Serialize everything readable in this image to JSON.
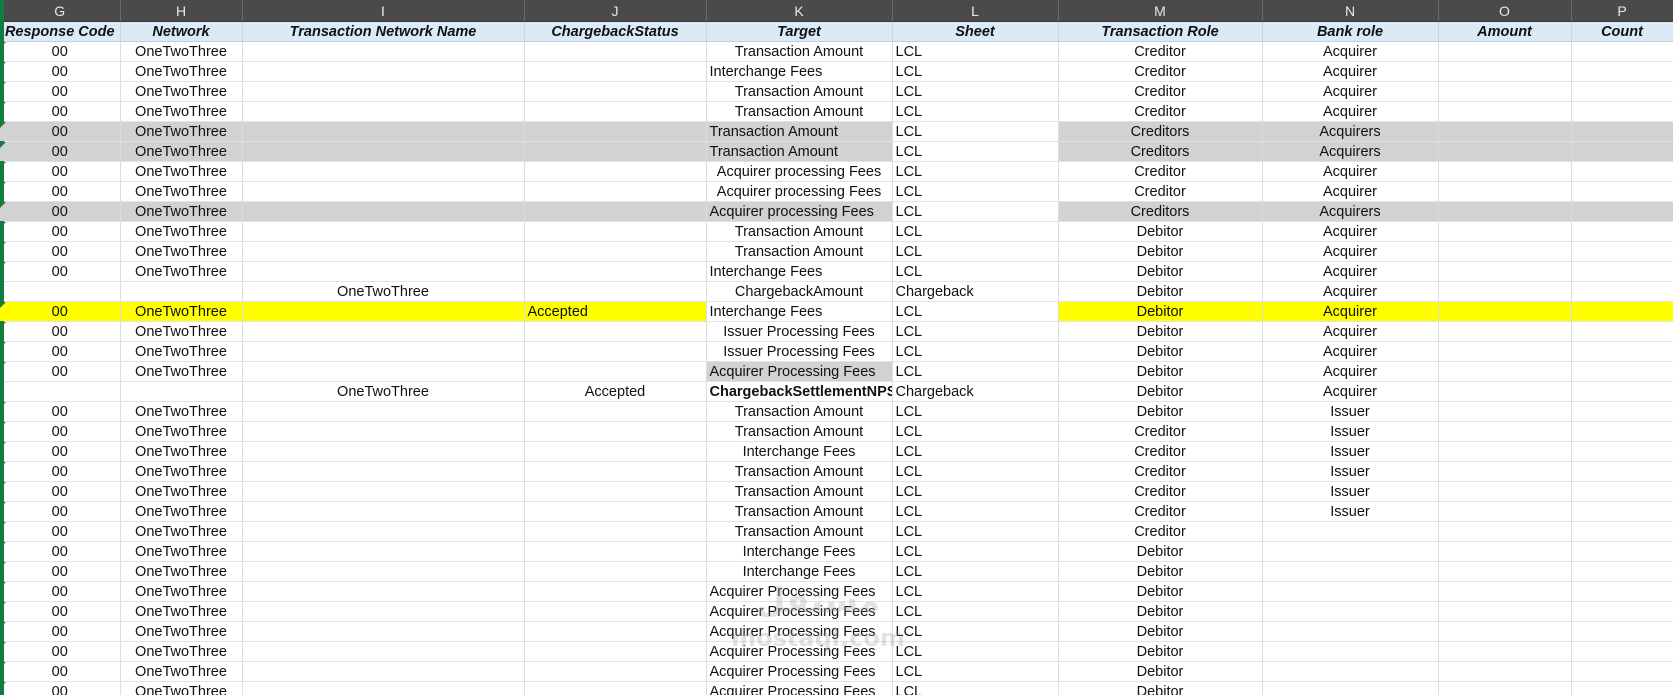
{
  "columns": {
    "letters": [
      "G",
      "H",
      "I",
      "J",
      "K",
      "L",
      "M",
      "N",
      "O",
      "P"
    ],
    "headers": [
      "Response Code",
      "Network",
      "Transaction Network Name",
      "ChargebackStatus",
      "Target",
      "Sheet",
      "Transaction Role",
      "Bank role",
      "Amount",
      "Count"
    ]
  },
  "colors": {
    "gray_fill": "#d2d2d2",
    "yellow_fill": "#ffff00",
    "header_fill": "#dce9f7",
    "error_triangle": "#1e7a32"
  },
  "rows": [
    {
      "g": "00",
      "h": "OneTwoThree",
      "i": "",
      "j": "",
      "k": "Transaction Amount",
      "l": "LCL",
      "m": "Creditor",
      "n": "Acquirer",
      "ka": "c",
      "tri": true
    },
    {
      "g": "00",
      "h": "OneTwoThree",
      "i": "",
      "j": "",
      "k": "Interchange Fees",
      "l": "LCL",
      "m": "Creditor",
      "n": "Acquirer",
      "ka": "l",
      "tri": true
    },
    {
      "g": "00",
      "h": "OneTwoThree",
      "i": "",
      "j": "",
      "k": "Transaction Amount",
      "l": "LCL",
      "m": "Creditor",
      "n": "Acquirer",
      "ka": "c",
      "tri": true
    },
    {
      "g": "00",
      "h": "OneTwoThree",
      "i": "",
      "j": "",
      "k": "Transaction Amount",
      "l": "LCL",
      "m": "Creditor",
      "n": "Acquirer",
      "ka": "c",
      "tri": true
    },
    {
      "g": "00",
      "h": "OneTwoThree",
      "i": "",
      "j": "",
      "k": "Transaction Amount",
      "l": "LCL",
      "m": "Creditors",
      "n": "Acquirers",
      "ka": "l",
      "tri": true,
      "hl": "gray",
      "hl_scope": "partial"
    },
    {
      "g": "00",
      "h": "OneTwoThree",
      "i": "",
      "j": "",
      "k": "Transaction Amount",
      "l": "LCL",
      "m": "Creditors",
      "n": "Acquirers",
      "ka": "l",
      "tri": true,
      "hl": "gray",
      "hl_scope": "partial"
    },
    {
      "g": "00",
      "h": "OneTwoThree",
      "i": "",
      "j": "",
      "k": "Acquirer processing Fees",
      "l": "LCL",
      "m": "Creditor",
      "n": "Acquirer",
      "ka": "c",
      "tri": true
    },
    {
      "g": "00",
      "h": "OneTwoThree",
      "i": "",
      "j": "",
      "k": "Acquirer processing Fees",
      "l": "LCL",
      "m": "Creditor",
      "n": "Acquirer",
      "ka": "c",
      "tri": true
    },
    {
      "g": "00",
      "h": "OneTwoThree",
      "i": "",
      "j": "",
      "k": "Acquirer processing Fees",
      "l": "LCL",
      "m": "Creditors",
      "n": "Acquirers",
      "ka": "l",
      "tri": true,
      "hl": "gray",
      "hl_scope": "partial"
    },
    {
      "g": "00",
      "h": "OneTwoThree",
      "i": "",
      "j": "",
      "k": "Transaction Amount",
      "l": "LCL",
      "m": "Debitor",
      "n": "Acquirer",
      "ka": "c",
      "tri": true
    },
    {
      "g": "00",
      "h": "OneTwoThree",
      "i": "",
      "j": "",
      "k": "Transaction Amount",
      "l": "LCL",
      "m": "Debitor",
      "n": "Acquirer",
      "ka": "c",
      "tri": true
    },
    {
      "g": "00",
      "h": "OneTwoThree",
      "i": "",
      "j": "",
      "k": "Interchange Fees",
      "l": "LCL",
      "m": "Debitor",
      "n": "Acquirer",
      "ka": "l",
      "tri": true
    },
    {
      "g": "",
      "h": "",
      "i": "OneTwoThree",
      "j": "",
      "k": "ChargebackAmount",
      "l": "Chargeback",
      "m": "Debitor",
      "n": "Acquirer",
      "ka": "c",
      "tri": false
    },
    {
      "g": "00",
      "h": "OneTwoThree",
      "i": "",
      "j": "Accepted",
      "k": "Interchange Fees",
      "l": "LCL",
      "m": "Debitor",
      "n": "Acquirer",
      "ka": "l",
      "ja": "l",
      "tri": true,
      "hl": "yellow",
      "hl_scope": "partial"
    },
    {
      "g": "00",
      "h": "OneTwoThree",
      "i": "",
      "j": "",
      "k": "Issuer Processing Fees",
      "l": "LCL",
      "m": "Debitor",
      "n": "Acquirer",
      "ka": "c",
      "tri": true
    },
    {
      "g": "00",
      "h": "OneTwoThree",
      "i": "",
      "j": "",
      "k": "Issuer Processing Fees",
      "l": "LCL",
      "m": "Debitor",
      "n": "Acquirer",
      "ka": "c",
      "tri": true
    },
    {
      "g": "00",
      "h": "OneTwoThree",
      "i": "",
      "j": "",
      "k": "Acquirer Processing Fees",
      "l": "LCL",
      "m": "Debitor",
      "n": "Acquirer",
      "ka": "l",
      "tri": true,
      "hl": "kgray"
    },
    {
      "g": "",
      "h": "",
      "i": "OneTwoThree",
      "j": "Accepted",
      "k": "ChargebackSettlementNPS",
      "l": "Chargeback",
      "m": "Debitor",
      "n": "Acquirer",
      "ka": "l",
      "kb": true,
      "tri": false
    },
    {
      "g": "00",
      "h": "OneTwoThree",
      "i": "",
      "j": "",
      "k": "Transaction Amount",
      "l": "LCL",
      "m": "Debitor",
      "n": "Issuer",
      "ka": "c",
      "tri": true
    },
    {
      "g": "00",
      "h": "OneTwoThree",
      "i": "",
      "j": "",
      "k": "Transaction Amount",
      "l": "LCL",
      "m": "Creditor",
      "n": "Issuer",
      "ka": "c",
      "tri": true
    },
    {
      "g": "00",
      "h": "OneTwoThree",
      "i": "",
      "j": "",
      "k": "Interchange Fees",
      "l": "LCL",
      "m": "Creditor",
      "n": "Issuer",
      "ka": "c",
      "tri": true
    },
    {
      "g": "00",
      "h": "OneTwoThree",
      "i": "",
      "j": "",
      "k": "Transaction Amount",
      "l": "LCL",
      "m": "Creditor",
      "n": "Issuer",
      "ka": "c",
      "tri": true
    },
    {
      "g": "00",
      "h": "OneTwoThree",
      "i": "",
      "j": "",
      "k": "Transaction Amount",
      "l": "LCL",
      "m": "Creditor",
      "n": "Issuer",
      "ka": "c",
      "tri": true
    },
    {
      "g": "00",
      "h": "OneTwoThree",
      "i": "",
      "j": "",
      "k": "Transaction Amount",
      "l": "LCL",
      "m": "Creditor",
      "n": "Issuer",
      "ka": "c",
      "tri": true
    },
    {
      "g": "00",
      "h": "OneTwoThree",
      "i": "",
      "j": "",
      "k": "Transaction Amount",
      "l": "LCL",
      "m": "Creditor",
      "n": "",
      "ka": "c",
      "tri": true
    },
    {
      "g": "00",
      "h": "OneTwoThree",
      "i": "",
      "j": "",
      "k": "Interchange Fees",
      "l": "LCL",
      "m": "Debitor",
      "n": "",
      "ka": "c",
      "tri": true
    },
    {
      "g": "00",
      "h": "OneTwoThree",
      "i": "",
      "j": "",
      "k": "Interchange Fees",
      "l": "LCL",
      "m": "Debitor",
      "n": "",
      "ka": "c",
      "tri": true
    },
    {
      "g": "00",
      "h": "OneTwoThree",
      "i": "",
      "j": "",
      "k": "Acquirer Processing Fees",
      "l": "LCL",
      "m": "Debitor",
      "n": "",
      "ka": "l",
      "tri": true
    },
    {
      "g": "00",
      "h": "OneTwoThree",
      "i": "",
      "j": "",
      "k": "Acquirer Processing Fees",
      "l": "LCL",
      "m": "Debitor",
      "n": "",
      "ka": "l",
      "tri": true
    },
    {
      "g": "00",
      "h": "OneTwoThree",
      "i": "",
      "j": "",
      "k": "Acquirer Processing Fees",
      "l": "LCL",
      "m": "Debitor",
      "n": "",
      "ka": "l",
      "tri": true
    },
    {
      "g": "00",
      "h": "OneTwoThree",
      "i": "",
      "j": "",
      "k": "Acquirer Processing Fees",
      "l": "LCL",
      "m": "Debitor",
      "n": "",
      "ka": "l",
      "tri": true
    },
    {
      "g": "00",
      "h": "OneTwoThree",
      "i": "",
      "j": "",
      "k": "Acquirer Processing Fees",
      "l": "LCL",
      "m": "Debitor",
      "n": "",
      "ka": "l",
      "tri": true
    },
    {
      "g": "00",
      "h": "OneTwoThree",
      "i": "",
      "j": "",
      "k": "Acquirer Processing Fees",
      "l": "LCL",
      "m": "Debitor",
      "n": "",
      "ka": "l",
      "tri": true
    }
  ],
  "watermark": {
    "text": "mostaql.com",
    "name": "mostaql-logo"
  }
}
